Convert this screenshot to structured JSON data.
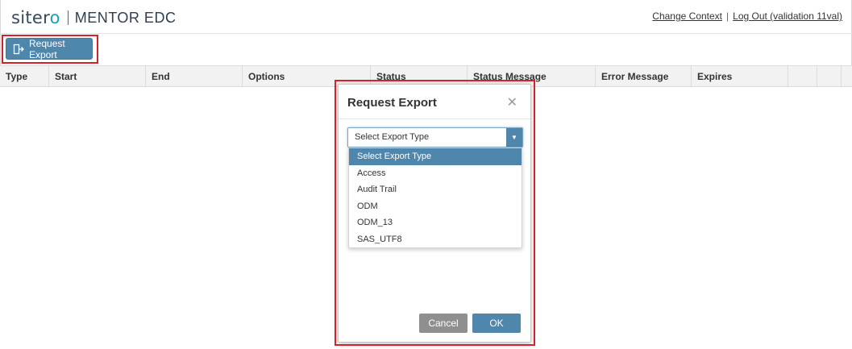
{
  "header": {
    "brand": "sitero",
    "product": "MENTOR EDC",
    "links": [
      "Change Context",
      "Log Out (validation 11val)"
    ]
  },
  "toolbar": {
    "request_export_label": "Request Export",
    "request_export_icon": "export-icon"
  },
  "table": {
    "columns": [
      "Type",
      "Start",
      "End",
      "Options",
      "Status",
      "Status Message",
      "Error Message",
      "Expires",
      "",
      ""
    ]
  },
  "modal": {
    "title": "Request Export",
    "close_icon": "close-icon",
    "select": {
      "value": "Select Export Type",
      "options": [
        "Select Export Type",
        "Access",
        "Audit Trail",
        "ODM",
        "ODM_13",
        "SAS_UTF8"
      ]
    },
    "cancel_label": "Cancel",
    "ok_label": "OK"
  },
  "colors": {
    "accent": "#4f86ab",
    "highlight": "#d9202a",
    "cancel": "#8f8f8f",
    "logo_accent": "#17a2b8"
  }
}
